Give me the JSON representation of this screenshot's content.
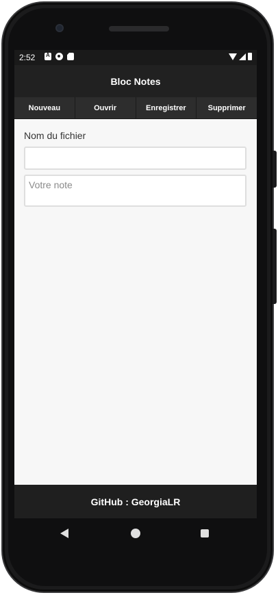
{
  "status_bar": {
    "time": "2:52",
    "icons_left": [
      "notification-a-icon",
      "notification-p-icon",
      "sd-card-icon"
    ],
    "icons_right": [
      "wifi-icon",
      "signal-icon",
      "battery-icon"
    ]
  },
  "app": {
    "title": "Bloc Notes"
  },
  "toolbar": {
    "buttons": [
      {
        "label": "Nouveau"
      },
      {
        "label": "Ouvrir"
      },
      {
        "label": "Enregistrer"
      },
      {
        "label": "Supprimer"
      }
    ]
  },
  "form": {
    "filename_label": "Nom du fichier",
    "filename_value": "",
    "note_placeholder": "Votre note",
    "note_value": ""
  },
  "footer": {
    "text": "GitHub : GeorgiaLR"
  },
  "colors": {
    "app_bar": "#212121",
    "toolbar_button": "#2d2d2d",
    "content_background": "#f7f7f7",
    "footer": "#1f1f1f"
  }
}
